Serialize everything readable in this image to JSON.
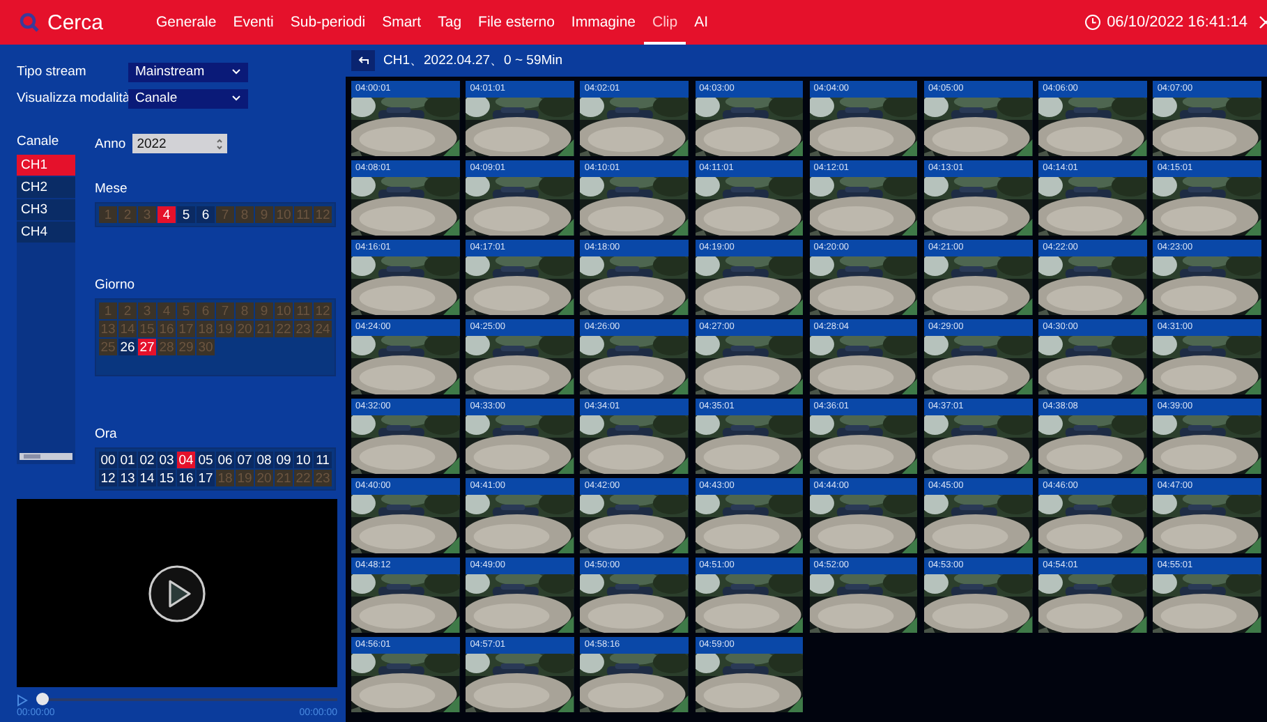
{
  "topbar": {
    "title": "Cerca",
    "tabs": [
      {
        "label": "Generale",
        "selected": false
      },
      {
        "label": "Eventi",
        "selected": false
      },
      {
        "label": "Sub-periodi",
        "selected": false
      },
      {
        "label": "Smart",
        "selected": false
      },
      {
        "label": "Tag",
        "selected": false
      },
      {
        "label": "File esterno",
        "selected": false
      },
      {
        "label": "Immagine",
        "selected": false
      },
      {
        "label": "Clip",
        "selected": true
      },
      {
        "label": "AI",
        "selected": false
      }
    ],
    "datetime": "06/10/2022 16:41:14"
  },
  "filters": [
    {
      "label": "Tipo stream",
      "value": "Mainstream"
    },
    {
      "label": "Visualizza modalità",
      "value": "Canale"
    }
  ],
  "channels": {
    "label": "Canale",
    "items": [
      {
        "label": "CH1",
        "selected": true
      },
      {
        "label": "CH2",
        "selected": false
      },
      {
        "label": "CH3",
        "selected": false
      },
      {
        "label": "CH4",
        "selected": false
      }
    ]
  },
  "year": {
    "label": "Anno",
    "value": "2022"
  },
  "months": {
    "label": "Mese",
    "items": [
      {
        "label": "1",
        "disabled": true,
        "selected": false
      },
      {
        "label": "2",
        "disabled": true,
        "selected": false
      },
      {
        "label": "3",
        "disabled": true,
        "selected": false
      },
      {
        "label": "4",
        "disabled": false,
        "selected": true
      },
      {
        "label": "5",
        "disabled": false,
        "selected": false
      },
      {
        "label": "6",
        "disabled": false,
        "selected": false
      },
      {
        "label": "7",
        "disabled": true,
        "selected": false
      },
      {
        "label": "8",
        "disabled": true,
        "selected": false
      },
      {
        "label": "9",
        "disabled": true,
        "selected": false
      },
      {
        "label": "10",
        "disabled": true,
        "selected": false
      },
      {
        "label": "11",
        "disabled": true,
        "selected": false
      },
      {
        "label": "12",
        "disabled": true,
        "selected": false
      }
    ]
  },
  "days": {
    "label": "Giorno",
    "items": [
      {
        "label": "1",
        "disabled": true,
        "selected": false
      },
      {
        "label": "2",
        "disabled": true,
        "selected": false
      },
      {
        "label": "3",
        "disabled": true,
        "selected": false
      },
      {
        "label": "4",
        "disabled": true,
        "selected": false
      },
      {
        "label": "5",
        "disabled": true,
        "selected": false
      },
      {
        "label": "6",
        "disabled": true,
        "selected": false
      },
      {
        "label": "7",
        "disabled": true,
        "selected": false
      },
      {
        "label": "8",
        "disabled": true,
        "selected": false
      },
      {
        "label": "9",
        "disabled": true,
        "selected": false
      },
      {
        "label": "10",
        "disabled": true,
        "selected": false
      },
      {
        "label": "11",
        "disabled": true,
        "selected": false
      },
      {
        "label": "12",
        "disabled": true,
        "selected": false
      },
      {
        "label": "13",
        "disabled": true,
        "selected": false
      },
      {
        "label": "14",
        "disabled": true,
        "selected": false
      },
      {
        "label": "15",
        "disabled": true,
        "selected": false
      },
      {
        "label": "16",
        "disabled": true,
        "selected": false
      },
      {
        "label": "17",
        "disabled": true,
        "selected": false
      },
      {
        "label": "18",
        "disabled": true,
        "selected": false
      },
      {
        "label": "19",
        "disabled": true,
        "selected": false
      },
      {
        "label": "20",
        "disabled": true,
        "selected": false
      },
      {
        "label": "21",
        "disabled": true,
        "selected": false
      },
      {
        "label": "22",
        "disabled": true,
        "selected": false
      },
      {
        "label": "23",
        "disabled": true,
        "selected": false
      },
      {
        "label": "24",
        "disabled": true,
        "selected": false
      },
      {
        "label": "25",
        "disabled": true,
        "selected": false
      },
      {
        "label": "26",
        "disabled": false,
        "selected": false
      },
      {
        "label": "27",
        "disabled": false,
        "selected": true
      },
      {
        "label": "28",
        "disabled": true,
        "selected": false
      },
      {
        "label": "29",
        "disabled": true,
        "selected": false
      },
      {
        "label": "30",
        "disabled": true,
        "selected": false
      }
    ]
  },
  "hours": {
    "label": "Ora",
    "items": [
      {
        "label": "00",
        "disabled": false,
        "selected": false
      },
      {
        "label": "01",
        "disabled": false,
        "selected": false
      },
      {
        "label": "02",
        "disabled": false,
        "selected": false
      },
      {
        "label": "03",
        "disabled": false,
        "selected": false
      },
      {
        "label": "04",
        "disabled": false,
        "selected": true
      },
      {
        "label": "05",
        "disabled": false,
        "selected": false
      },
      {
        "label": "06",
        "disabled": false,
        "selected": false
      },
      {
        "label": "07",
        "disabled": false,
        "selected": false
      },
      {
        "label": "08",
        "disabled": false,
        "selected": false
      },
      {
        "label": "09",
        "disabled": false,
        "selected": false
      },
      {
        "label": "10",
        "disabled": false,
        "selected": false
      },
      {
        "label": "11",
        "disabled": false,
        "selected": false
      },
      {
        "label": "12",
        "disabled": false,
        "selected": false
      },
      {
        "label": "13",
        "disabled": false,
        "selected": false
      },
      {
        "label": "14",
        "disabled": false,
        "selected": false
      },
      {
        "label": "15",
        "disabled": false,
        "selected": false
      },
      {
        "label": "16",
        "disabled": false,
        "selected": false
      },
      {
        "label": "17",
        "disabled": false,
        "selected": false
      },
      {
        "label": "18",
        "disabled": true,
        "selected": false
      },
      {
        "label": "19",
        "disabled": true,
        "selected": false
      },
      {
        "label": "20",
        "disabled": true,
        "selected": false
      },
      {
        "label": "21",
        "disabled": true,
        "selected": false
      },
      {
        "label": "22",
        "disabled": true,
        "selected": false
      },
      {
        "label": "23",
        "disabled": true,
        "selected": false
      }
    ]
  },
  "player": {
    "level": 0,
    "start_time": "00:00:00",
    "end_time": "00:00:00"
  },
  "clips": {
    "header": "CH1、2022.04.27、0 ~ 59Min",
    "items": [
      {
        "time": "04:00:01"
      },
      {
        "time": "04:01:01"
      },
      {
        "time": "04:02:01"
      },
      {
        "time": "04:03:00"
      },
      {
        "time": "04:04:00"
      },
      {
        "time": "04:05:00"
      },
      {
        "time": "04:06:00"
      },
      {
        "time": "04:07:00"
      },
      {
        "time": "04:08:01"
      },
      {
        "time": "04:09:01"
      },
      {
        "time": "04:10:01"
      },
      {
        "time": "04:11:01"
      },
      {
        "time": "04:12:01"
      },
      {
        "time": "04:13:01"
      },
      {
        "time": "04:14:01"
      },
      {
        "time": "04:15:01"
      },
      {
        "time": "04:16:01"
      },
      {
        "time": "04:17:01"
      },
      {
        "time": "04:18:00"
      },
      {
        "time": "04:19:00"
      },
      {
        "time": "04:20:00"
      },
      {
        "time": "04:21:00"
      },
      {
        "time": "04:22:00"
      },
      {
        "time": "04:23:00"
      },
      {
        "time": "04:24:00"
      },
      {
        "time": "04:25:00"
      },
      {
        "time": "04:26:00"
      },
      {
        "time": "04:27:00"
      },
      {
        "time": "04:28:04"
      },
      {
        "time": "04:29:00"
      },
      {
        "time": "04:30:00"
      },
      {
        "time": "04:31:00"
      },
      {
        "time": "04:32:00"
      },
      {
        "time": "04:33:00"
      },
      {
        "time": "04:34:01"
      },
      {
        "time": "04:35:01"
      },
      {
        "time": "04:36:01"
      },
      {
        "time": "04:37:01"
      },
      {
        "time": "04:38:08"
      },
      {
        "time": "04:39:00"
      },
      {
        "time": "04:40:00"
      },
      {
        "time": "04:41:00"
      },
      {
        "time": "04:42:00"
      },
      {
        "time": "04:43:00"
      },
      {
        "time": "04:44:00"
      },
      {
        "time": "04:45:00"
      },
      {
        "time": "04:46:00"
      },
      {
        "time": "04:47:00"
      },
      {
        "time": "04:48:12"
      },
      {
        "time": "04:49:00"
      },
      {
        "time": "04:50:00"
      },
      {
        "time": "04:51:00"
      },
      {
        "time": "04:52:00"
      },
      {
        "time": "04:53:00"
      },
      {
        "time": "04:54:01"
      },
      {
        "time": "04:55:01"
      },
      {
        "time": "04:56:01"
      },
      {
        "time": "04:57:01"
      },
      {
        "time": "04:58:16"
      },
      {
        "time": "04:59:00"
      }
    ]
  }
}
